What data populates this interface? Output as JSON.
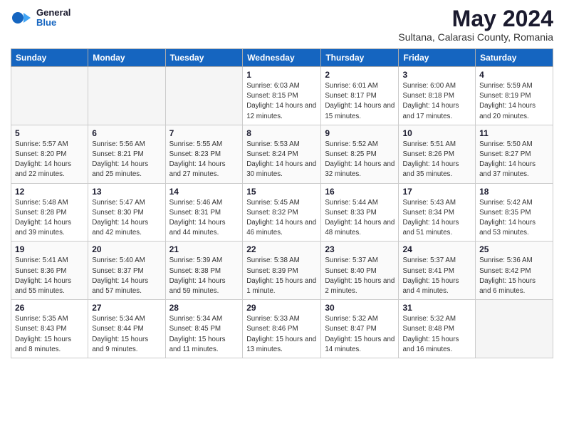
{
  "header": {
    "logo_general": "General",
    "logo_blue": "Blue",
    "month_title": "May 2024",
    "subtitle": "Sultana, Calarasi County, Romania"
  },
  "days_of_week": [
    "Sunday",
    "Monday",
    "Tuesday",
    "Wednesday",
    "Thursday",
    "Friday",
    "Saturday"
  ],
  "weeks": [
    [
      {
        "day": "",
        "empty": true
      },
      {
        "day": "",
        "empty": true
      },
      {
        "day": "",
        "empty": true
      },
      {
        "day": "1",
        "sunrise": "6:03 AM",
        "sunset": "8:15 PM",
        "daylight": "14 hours and 12 minutes."
      },
      {
        "day": "2",
        "sunrise": "6:01 AM",
        "sunset": "8:17 PM",
        "daylight": "14 hours and 15 minutes."
      },
      {
        "day": "3",
        "sunrise": "6:00 AM",
        "sunset": "8:18 PM",
        "daylight": "14 hours and 17 minutes."
      },
      {
        "day": "4",
        "sunrise": "5:59 AM",
        "sunset": "8:19 PM",
        "daylight": "14 hours and 20 minutes."
      }
    ],
    [
      {
        "day": "5",
        "sunrise": "5:57 AM",
        "sunset": "8:20 PM",
        "daylight": "14 hours and 22 minutes."
      },
      {
        "day": "6",
        "sunrise": "5:56 AM",
        "sunset": "8:21 PM",
        "daylight": "14 hours and 25 minutes."
      },
      {
        "day": "7",
        "sunrise": "5:55 AM",
        "sunset": "8:23 PM",
        "daylight": "14 hours and 27 minutes."
      },
      {
        "day": "8",
        "sunrise": "5:53 AM",
        "sunset": "8:24 PM",
        "daylight": "14 hours and 30 minutes."
      },
      {
        "day": "9",
        "sunrise": "5:52 AM",
        "sunset": "8:25 PM",
        "daylight": "14 hours and 32 minutes."
      },
      {
        "day": "10",
        "sunrise": "5:51 AM",
        "sunset": "8:26 PM",
        "daylight": "14 hours and 35 minutes."
      },
      {
        "day": "11",
        "sunrise": "5:50 AM",
        "sunset": "8:27 PM",
        "daylight": "14 hours and 37 minutes."
      }
    ],
    [
      {
        "day": "12",
        "sunrise": "5:48 AM",
        "sunset": "8:28 PM",
        "daylight": "14 hours and 39 minutes."
      },
      {
        "day": "13",
        "sunrise": "5:47 AM",
        "sunset": "8:30 PM",
        "daylight": "14 hours and 42 minutes."
      },
      {
        "day": "14",
        "sunrise": "5:46 AM",
        "sunset": "8:31 PM",
        "daylight": "14 hours and 44 minutes."
      },
      {
        "day": "15",
        "sunrise": "5:45 AM",
        "sunset": "8:32 PM",
        "daylight": "14 hours and 46 minutes."
      },
      {
        "day": "16",
        "sunrise": "5:44 AM",
        "sunset": "8:33 PM",
        "daylight": "14 hours and 48 minutes."
      },
      {
        "day": "17",
        "sunrise": "5:43 AM",
        "sunset": "8:34 PM",
        "daylight": "14 hours and 51 minutes."
      },
      {
        "day": "18",
        "sunrise": "5:42 AM",
        "sunset": "8:35 PM",
        "daylight": "14 hours and 53 minutes."
      }
    ],
    [
      {
        "day": "19",
        "sunrise": "5:41 AM",
        "sunset": "8:36 PM",
        "daylight": "14 hours and 55 minutes."
      },
      {
        "day": "20",
        "sunrise": "5:40 AM",
        "sunset": "8:37 PM",
        "daylight": "14 hours and 57 minutes."
      },
      {
        "day": "21",
        "sunrise": "5:39 AM",
        "sunset": "8:38 PM",
        "daylight": "14 hours and 59 minutes."
      },
      {
        "day": "22",
        "sunrise": "5:38 AM",
        "sunset": "8:39 PM",
        "daylight": "15 hours and 1 minute."
      },
      {
        "day": "23",
        "sunrise": "5:37 AM",
        "sunset": "8:40 PM",
        "daylight": "15 hours and 2 minutes."
      },
      {
        "day": "24",
        "sunrise": "5:37 AM",
        "sunset": "8:41 PM",
        "daylight": "15 hours and 4 minutes."
      },
      {
        "day": "25",
        "sunrise": "5:36 AM",
        "sunset": "8:42 PM",
        "daylight": "15 hours and 6 minutes."
      }
    ],
    [
      {
        "day": "26",
        "sunrise": "5:35 AM",
        "sunset": "8:43 PM",
        "daylight": "15 hours and 8 minutes."
      },
      {
        "day": "27",
        "sunrise": "5:34 AM",
        "sunset": "8:44 PM",
        "daylight": "15 hours and 9 minutes."
      },
      {
        "day": "28",
        "sunrise": "5:34 AM",
        "sunset": "8:45 PM",
        "daylight": "15 hours and 11 minutes."
      },
      {
        "day": "29",
        "sunrise": "5:33 AM",
        "sunset": "8:46 PM",
        "daylight": "15 hours and 13 minutes."
      },
      {
        "day": "30",
        "sunrise": "5:32 AM",
        "sunset": "8:47 PM",
        "daylight": "15 hours and 14 minutes."
      },
      {
        "day": "31",
        "sunrise": "5:32 AM",
        "sunset": "8:48 PM",
        "daylight": "15 hours and 16 minutes."
      },
      {
        "day": "",
        "empty": true
      }
    ]
  ],
  "labels": {
    "sunrise": "Sunrise:",
    "sunset": "Sunset:",
    "daylight": "Daylight:"
  }
}
